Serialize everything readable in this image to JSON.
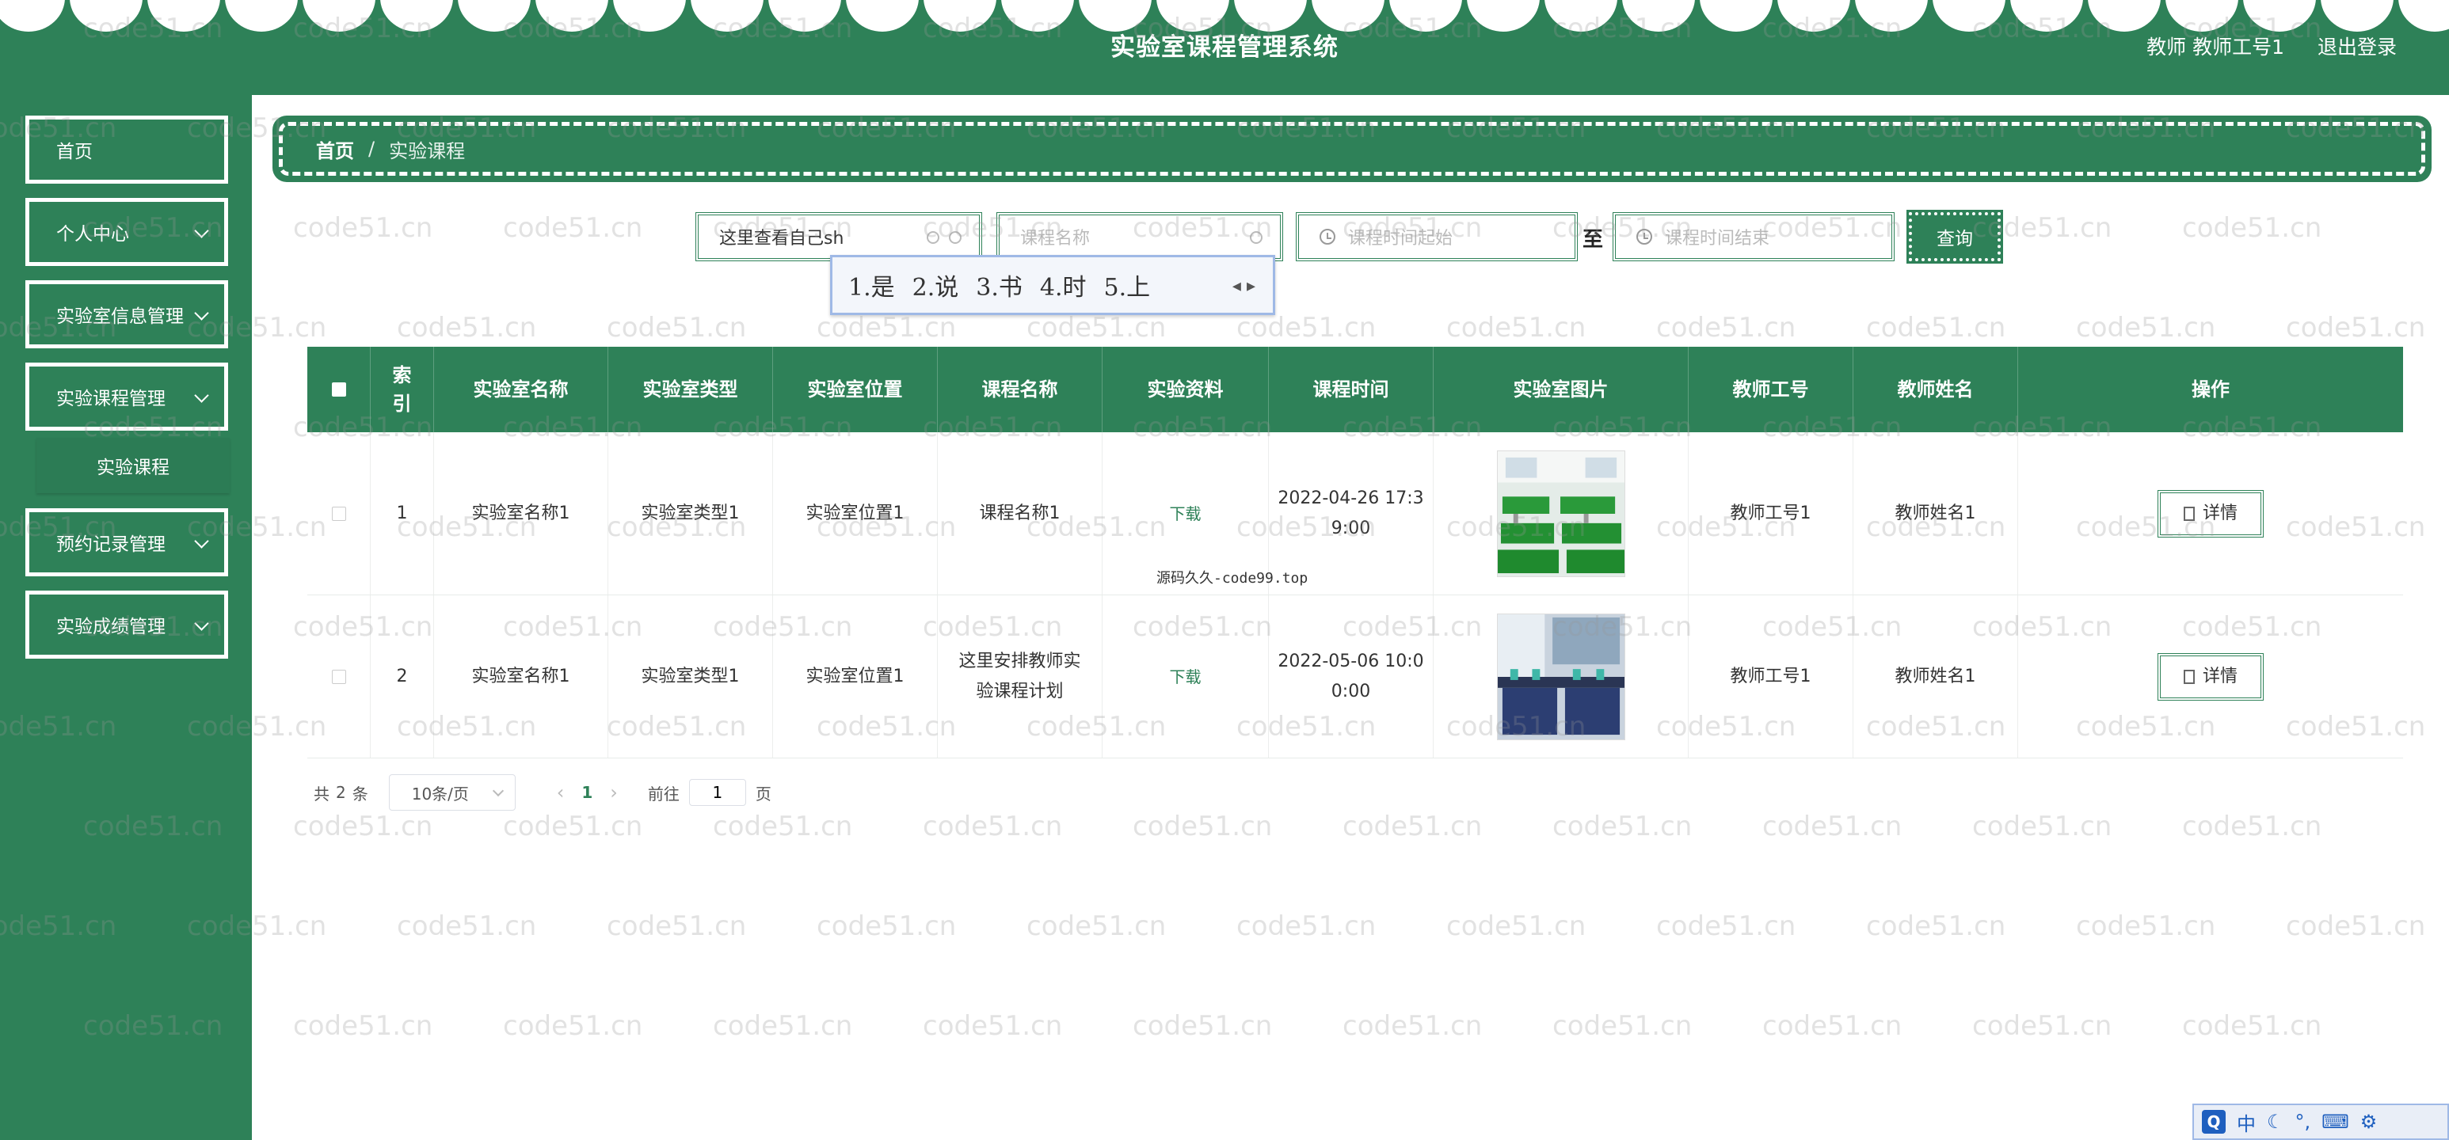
{
  "header": {
    "title": "实验室课程管理系统",
    "user_label": "教师 教师工号1",
    "logout_label": "退出登录"
  },
  "sidebar": {
    "items": [
      {
        "label": "首页"
      },
      {
        "label": "个人中心"
      },
      {
        "label": "实验室信息管理"
      },
      {
        "label": "实验课程管理"
      },
      {
        "label": "实验课程"
      },
      {
        "label": "预约记录管理"
      },
      {
        "label": "实验成绩管理"
      }
    ]
  },
  "breadcrumb": {
    "home": "首页",
    "separator": "/",
    "current": "实验课程"
  },
  "search": {
    "lab_name_value": "这里查看自己sh",
    "course_name_placeholder": "课程名称",
    "start_placeholder": "课程时间起始",
    "range_separator": "至",
    "end_placeholder": "课程时间结束",
    "query_label": "查询"
  },
  "ime": {
    "candidates": [
      "1.是",
      "2.说",
      "3.书",
      "4.时",
      "5.上"
    ],
    "arrows": "◂ ▸"
  },
  "table": {
    "headers": [
      "索引",
      "实验室名称",
      "实验室类型",
      "实验室位置",
      "课程名称",
      "实验资料",
      "课程时间",
      "实验室图片",
      "教师工号",
      "教师姓名",
      "操作"
    ],
    "rows": [
      {
        "index": "1",
        "lab_name": "实验室名称1",
        "lab_type": "实验室类型1",
        "lab_location": "实验室位置1",
        "course_name": "课程名称1",
        "material": "下载",
        "course_time": "2022-04-26 17:39:00",
        "teacher_id": "教师工号1",
        "teacher_name": "教师姓名1",
        "action": "详情"
      },
      {
        "index": "2",
        "lab_name": "实验室名称1",
        "lab_type": "实验室类型1",
        "lab_location": "实验室位置1",
        "course_name": "这里安排教师实验课程计划",
        "material": "下载",
        "course_time": "2022-05-06 10:00:00",
        "teacher_id": "教师工号1",
        "teacher_name": "教师姓名1",
        "action": "详情"
      }
    ]
  },
  "overlay_text": "源码久久-code99.top",
  "pagination": {
    "total_prefix": "共",
    "total": "2",
    "total_suffix": "条",
    "page_size": "10条/页",
    "current_page": "1",
    "goto_label": "前往",
    "goto_value": "1",
    "page_suffix": "页"
  },
  "watermark_text": "code51.cn",
  "tray": {
    "ime_mode": "中"
  },
  "colors": {
    "primary": "#2e8158",
    "white": "#ffffff"
  }
}
